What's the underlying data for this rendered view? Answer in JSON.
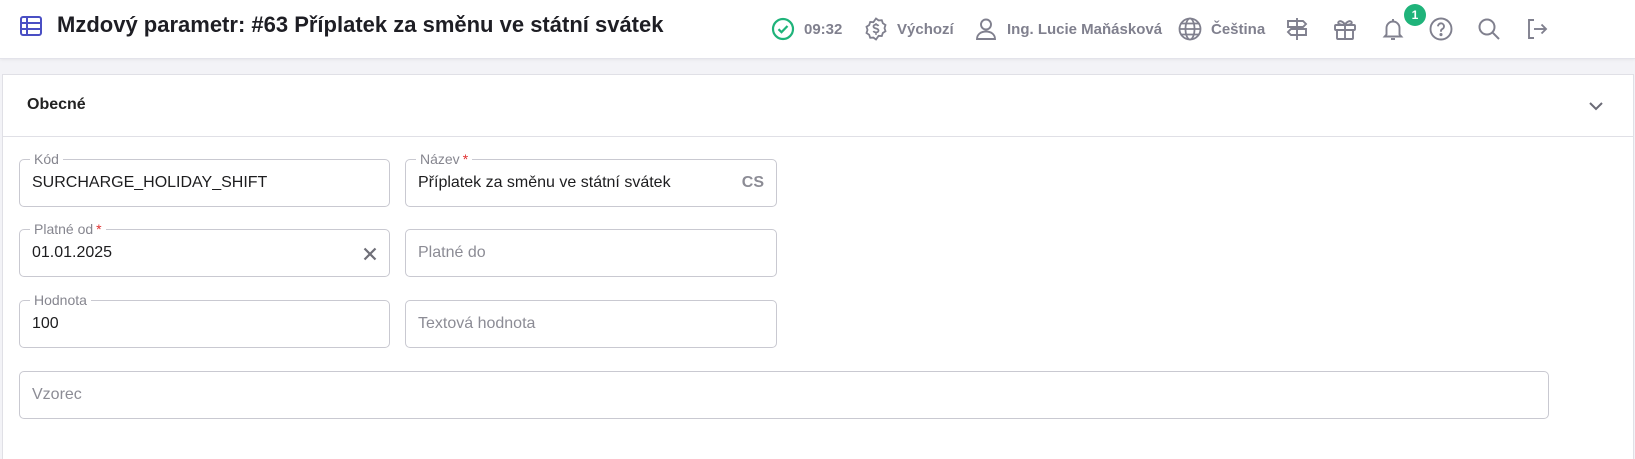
{
  "header": {
    "title": "Mzdový parametr: #63 Příplatek za směnu ve státní svátek",
    "time": "09:32",
    "currency_label": "Výchozí",
    "user_name": "Ing. Lucie Maňásková",
    "language": "Čeština",
    "gift_badge_count": "1",
    "icons": {
      "title": "table-icon",
      "status": "check-circle-icon",
      "currency": "dollar-badge-icon",
      "user": "user-icon",
      "language": "globe-icon",
      "signpost": "signpost-icon",
      "gift": "gift-icon",
      "notifications": "bell-icon",
      "help": "help-icon",
      "search": "search-icon",
      "logout": "logout-icon"
    }
  },
  "colors": {
    "accent": "#4a4fc4",
    "status_ok": "#1fb37a",
    "required": "#e03131",
    "muted_text": "#80808e"
  },
  "section": {
    "title": "Obecné",
    "expanded": true
  },
  "form": {
    "code": {
      "label": "Kód",
      "value": "SURCHARGE_HOLIDAY_SHIFT"
    },
    "name": {
      "label": "Název",
      "required_mark": "*",
      "value": "Příplatek za směnu ve státní svátek",
      "lang_suffix": "CS"
    },
    "valid_from": {
      "label": "Platné od",
      "required_mark": "*",
      "value": "01.01.2025"
    },
    "valid_to": {
      "placeholder": "Platné do"
    },
    "value": {
      "label": "Hodnota",
      "value": "100"
    },
    "text_value": {
      "placeholder": "Textová hodnota"
    },
    "formula": {
      "placeholder": "Vzorec"
    }
  }
}
